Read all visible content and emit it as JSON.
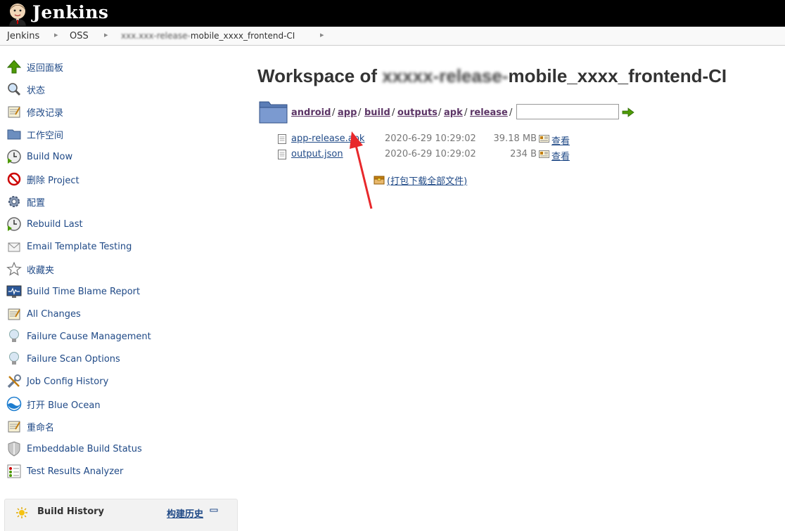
{
  "header": {
    "brand": "Jenkins"
  },
  "breadcrumbs": [
    {
      "label": "Jenkins"
    },
    {
      "label": "OSS"
    },
    {
      "label_blurred": "xxx.xxx-release-",
      "label": "mobile_xxxx_frontend-CI"
    }
  ],
  "sidebar": {
    "items": [
      {
        "label": "返回面板",
        "icon": "up-arrow-icon"
      },
      {
        "label": "状态",
        "icon": "search-icon"
      },
      {
        "label": "修改记录",
        "icon": "notepad-icon"
      },
      {
        "label": "工作空间",
        "icon": "folder-icon"
      },
      {
        "label": "Build Now",
        "icon": "clock-play-icon"
      },
      {
        "label": "删除 Project",
        "icon": "no-entry-icon"
      },
      {
        "label": "配置",
        "icon": "gear-icon"
      },
      {
        "label": "Rebuild Last",
        "icon": "clock-play-icon"
      },
      {
        "label": "Email Template Testing",
        "icon": "envelope-icon"
      },
      {
        "label": "收藏夹",
        "icon": "star-icon"
      },
      {
        "label": "Build Time Blame Report",
        "icon": "monitor-icon"
      },
      {
        "label": "All Changes",
        "icon": "notepad-icon"
      },
      {
        "label": "Failure Cause Management",
        "icon": "lightbulb-icon"
      },
      {
        "label": "Failure Scan Options",
        "icon": "lightbulb-icon"
      },
      {
        "label": "Job Config History",
        "icon": "tools-icon"
      },
      {
        "label": "打开 Blue Ocean",
        "icon": "blue-ocean-icon"
      },
      {
        "label": "重命名",
        "icon": "notepad-icon"
      },
      {
        "label": "Embeddable Build Status",
        "icon": "shield-icon"
      },
      {
        "label": "Test Results Analyzer",
        "icon": "test-results-icon"
      }
    ]
  },
  "build_history": {
    "title": "Build History",
    "link": "构建历史"
  },
  "main": {
    "title_prefix": "Workspace of ",
    "title_blurred": "xxxxx-release-",
    "title_suffix": "mobile_xxxx_frontend-CI",
    "path": [
      "android",
      "app",
      "build",
      "outputs",
      "apk",
      "release"
    ],
    "path_input": {
      "value": ""
    },
    "files": [
      {
        "name": "app-release.apk",
        "date": "2020-6-29 10:29:02",
        "size": "39.18 MB",
        "view": "查看"
      },
      {
        "name": "output.json",
        "date": "2020-6-29 10:29:02",
        "size": "234 B",
        "view": "查看"
      }
    ],
    "zip_download": "(打包下载全部文件)"
  },
  "colors": {
    "link": "#204a87",
    "visited": "#5c3566",
    "annotation_arrow": "#e8282b"
  }
}
